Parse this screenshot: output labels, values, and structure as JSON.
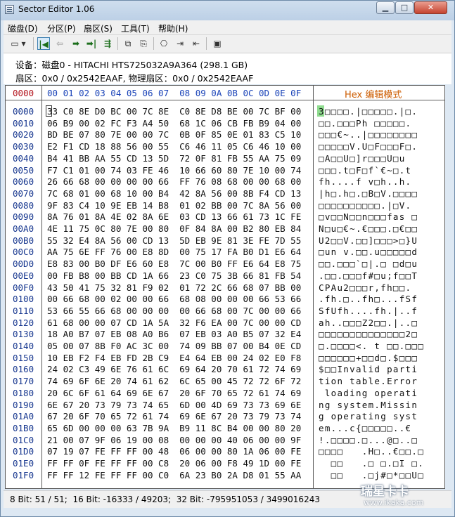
{
  "window": {
    "title": "Sector Editor 1.06",
    "minimize": "▁",
    "maximize": "□",
    "close": "✕"
  },
  "menu": [
    "磁盘(D)",
    "分区(P)",
    "扇区(S)",
    "工具(T)",
    "帮助(H)"
  ],
  "toolbar": {
    "drive": "▭ ▾",
    "first": "|◀",
    "prev": "⇦",
    "next": "➡",
    "last": "➡|",
    "goto": "⇶",
    "copy": "⧉",
    "paste": "⎘",
    "find": "⎔",
    "import": "⇥",
    "export": "⇤",
    "save": "▣"
  },
  "info": {
    "device_line": "设备：磁盘0 - HITACHI HTS725032A9A364 (298.1 GB)",
    "sector_line": "扇区：0x0 / 0x2542EAAF, 物理扇区：0x0 / 0x2542EAAF"
  },
  "grid": {
    "offset_header": "0000",
    "hex_header": "00 01 02 03 04 05 06 07  08 09 0A 0B 0C 0D 0E 0F",
    "ascii_header": "Hex 编辑模式",
    "rows": [
      {
        "offset": "0000",
        "hex": "33 C0 8E D0 BC 00 7C 8E  C0 8E D8 BE 00 7C BF 00",
        "ascii": "3□□□□.|□□□□□.|□."
      },
      {
        "offset": "0010",
        "hex": "06 B9 00 02 FC F3 A4 50  68 1C 06 CB FB B9 04 00",
        "ascii": "□□.□□□Ph □□□□□."
      },
      {
        "offset": "0020",
        "hex": "BD BE 07 80 7E 00 00 7C  0B 0F 85 0E 01 83 C5 10",
        "ascii": "□□□€~..|□□□□□□□□"
      },
      {
        "offset": "0030",
        "hex": "E2 F1 CD 18 88 56 00 55  C6 46 11 05 C6 46 10 00",
        "ascii": "□□□□□V.U□F□□□F□."
      },
      {
        "offset": "0040",
        "hex": "B4 41 BB AA 55 CD 13 5D  72 0F 81 FB 55 AA 75 09",
        "ascii": "□A□□U□]r□□□U□u"
      },
      {
        "offset": "0050",
        "hex": "F7 C1 01 00 74 03 FE 46  10 66 60 80 7E 10 00 74",
        "ascii": "□□□.t□F□f`€~□.t"
      },
      {
        "offset": "0060",
        "hex": "26 66 68 00 00 00 00 66  FF 76 08 68 00 00 68 00",
        "ascii": "fh....f v□h..h."
      },
      {
        "offset": "0070",
        "hex": "7C 68 01 00 68 10 00 B4  42 8A 56 00 8B F4 CD 13",
        "ascii": "|h□.h□.□B□V.□□□□"
      },
      {
        "offset": "0080",
        "hex": "9F 83 C4 10 9E EB 14 B8  01 02 BB 00 7C 8A 56 00",
        "ascii": "□□□□□□□□□□.|□V."
      },
      {
        "offset": "0090",
        "hex": "8A 76 01 8A 4E 02 8A 6E  03 CD 13 66 61 73 1C FE",
        "ascii": "□v□□N□□n□□□fas □"
      },
      {
        "offset": "00A0",
        "hex": "4E 11 75 0C 80 7E 00 80  0F 84 8A 00 B2 80 EB 84",
        "ascii": "N□u□€~.€□□□.□€□□"
      },
      {
        "offset": "00B0",
        "hex": "55 32 E4 8A 56 00 CD 13  5D EB 9E 81 3E FE 7D 55",
        "ascii": "U2□□V.□□]□□□>□}U"
      },
      {
        "offset": "00C0",
        "hex": "AA 75 6E FF 76 00 E8 8D  00 75 17 FA B0 D1 E6 64",
        "ascii": "□un v.□□.u□□□□□d"
      },
      {
        "offset": "00D0",
        "hex": "E8 83 00 B0 DF E6 60 E8  7C 00 B0 FF E6 64 E8 75",
        "ascii": "□□.□□□`□|.□ □d□u"
      },
      {
        "offset": "00E0",
        "hex": "00 FB B8 00 BB CD 1A 66  23 C0 75 3B 66 81 FB 54",
        "ascii": ".□□.□□□f#□u;f□□T"
      },
      {
        "offset": "00F0",
        "hex": "43 50 41 75 32 81 F9 02  01 72 2C 66 68 07 BB 00",
        "ascii": "CPAu2□□□r,fh□□."
      },
      {
        "offset": "0100",
        "hex": "00 66 68 00 02 00 00 66  68 08 00 00 00 66 53 66",
        "ascii": ".fh.□..fh□...fSf"
      },
      {
        "offset": "0110",
        "hex": "53 66 55 66 68 00 00 00  00 66 68 00 7C 00 00 66",
        "ascii": "SfUfh....fh.|..f"
      },
      {
        "offset": "0120",
        "hex": "61 68 00 00 07 CD 1A 5A  32 F6 EA 00 7C 00 00 CD",
        "ascii": "ah..□□□Z2□□.|..□"
      },
      {
        "offset": "0130",
        "hex": "18 A0 B7 07 EB 08 A0 B6  07 EB 03 A0 B5 07 32 E4",
        "ascii": "□□□□□□□□□□□□□□2□"
      },
      {
        "offset": "0140",
        "hex": "05 00 07 8B F0 AC 3C 00  74 09 BB 07 00 B4 0E CD",
        "ascii": "□.□□□□<. t □□.□□□"
      },
      {
        "offset": "0150",
        "hex": "10 EB F2 F4 EB FD 2B C9  E4 64 EB 00 24 02 E0 F8",
        "ascii": "□□□□□□+□□d□.$□□□"
      },
      {
        "offset": "0160",
        "hex": "24 02 C3 49 6E 76 61 6C  69 64 20 70 61 72 74 69",
        "ascii": "$□□Invalid parti"
      },
      {
        "offset": "0170",
        "hex": "74 69 6F 6E 20 74 61 62  6C 65 00 45 72 72 6F 72",
        "ascii": "tion table.Error"
      },
      {
        "offset": "0180",
        "hex": "20 6C 6F 61 64 69 6E 67  20 6F 70 65 72 61 74 69",
        "ascii": " loading operati"
      },
      {
        "offset": "0190",
        "hex": "6E 67 20 73 79 73 74 65  6D 00 4D 69 73 73 69 6E",
        "ascii": "ng system.Missin"
      },
      {
        "offset": "01A0",
        "hex": "67 20 6F 70 65 72 61 74  69 6E 67 20 73 79 73 74",
        "ascii": "g operating syst"
      },
      {
        "offset": "01B0",
        "hex": "65 6D 00 00 00 63 7B 9A  B9 11 8C B4 00 00 80 20",
        "ascii": "em...c{□□□□□..€ "
      },
      {
        "offset": "01C0",
        "hex": "21 00 07 9F 06 19 00 08  00 00 00 40 06 00 00 9F",
        "ascii": "!.□□□□.□...@□..□"
      },
      {
        "offset": "01D0",
        "hex": "07 19 07 FE FF FF 00 48  06 00 00 80 1A 06 00 FE",
        "ascii": "□□□□   .H□..€□□.□"
      },
      {
        "offset": "01E0",
        "hex": "FF FF 0F FE FF FF 00 C8  20 06 00 F8 49 1D 00 FE",
        "ascii": "  □□   .□ □.□I □."
      },
      {
        "offset": "01F0",
        "hex": "FF FF 12 FE FF FF 00 C0  6A 23 B0 2A D8 01 55 AA",
        "ascii": "  □□   .□j#□*□□U□"
      }
    ]
  },
  "status": {
    "text": "8 Bit: 51 / 51;  16 Bit: -16333 / 49203;  32 Bit: -795951053 / 3499016243"
  },
  "watermark": {
    "logo": "瑞星卡卡",
    "url": "www.ikaka.com"
  }
}
